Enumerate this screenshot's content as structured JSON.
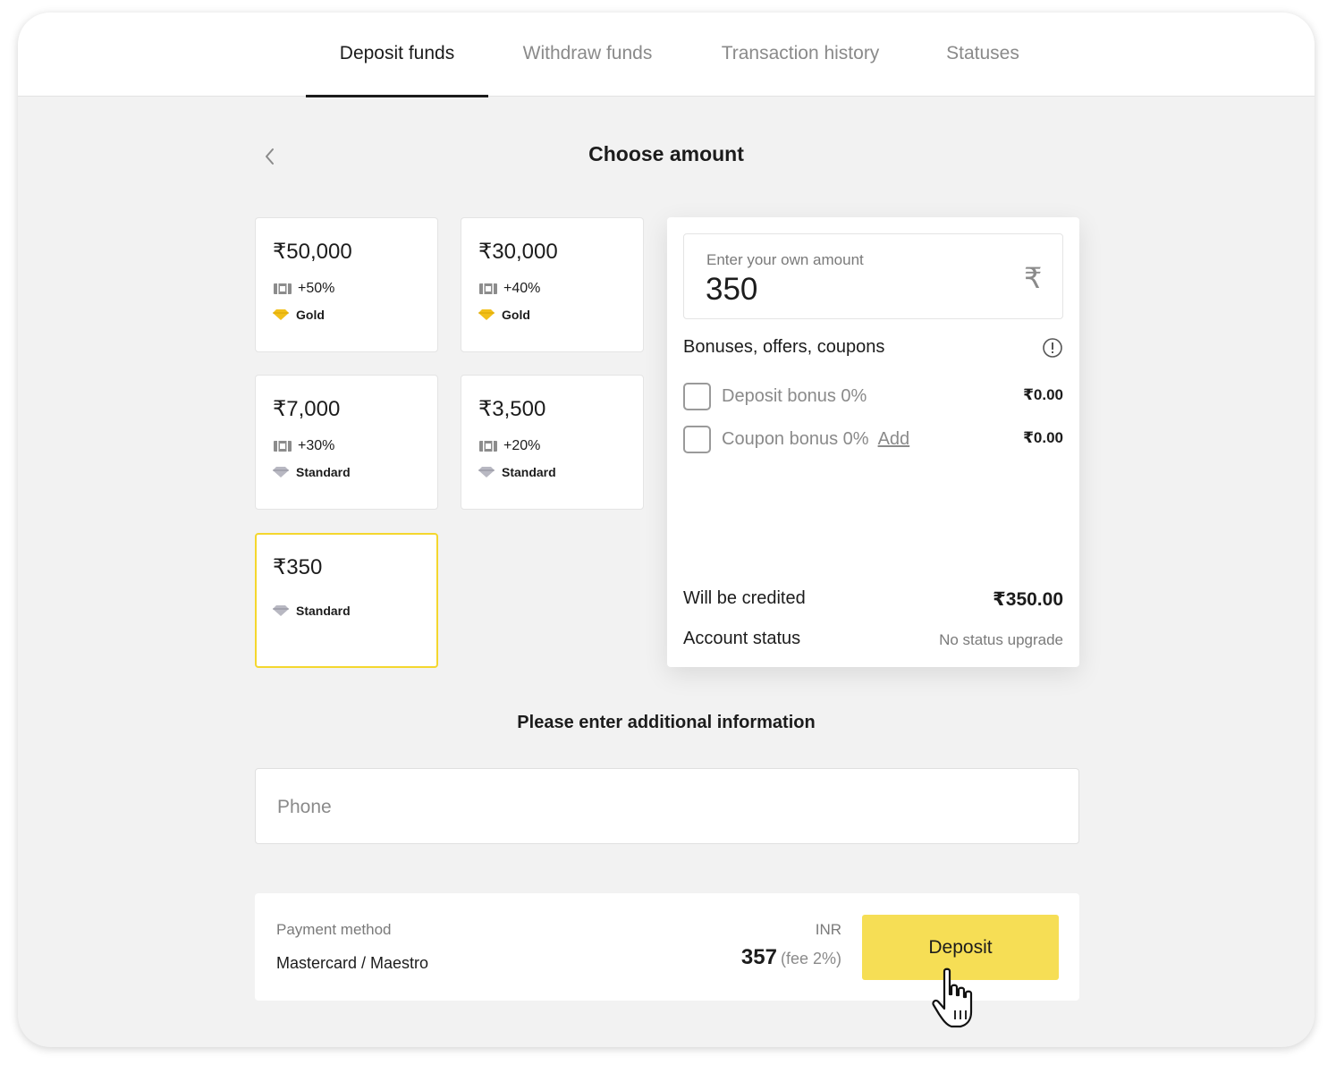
{
  "tabs": [
    {
      "label": "Deposit funds",
      "active": true
    },
    {
      "label": "Withdraw funds",
      "active": false
    },
    {
      "label": "Transaction history",
      "active": false
    },
    {
      "label": "Statuses",
      "active": false
    }
  ],
  "page_title": "Choose amount",
  "amount_options": [
    {
      "amount": "₹50,000",
      "bonus": "+50%",
      "status": "Gold"
    },
    {
      "amount": "₹30,000",
      "bonus": "+40%",
      "status": "Gold"
    },
    {
      "amount": "₹7,000",
      "bonus": "+30%",
      "status": "Standard"
    },
    {
      "amount": "₹3,500",
      "bonus": "+20%",
      "status": "Standard"
    },
    {
      "amount": "₹350",
      "bonus": "",
      "status": "Standard",
      "selected": true
    }
  ],
  "custom_amount": {
    "label": "Enter your own amount",
    "value": "350",
    "currency_symbol": "₹"
  },
  "bonuses": {
    "heading": "Bonuses, offers, coupons",
    "deposit_bonus": {
      "label": "Deposit bonus 0%",
      "value": "₹0.00",
      "checked": false
    },
    "coupon_bonus": {
      "label": "Coupon bonus 0%",
      "link": "Add",
      "value": "₹0.00",
      "checked": false
    }
  },
  "summary": {
    "credited_label": "Will be credited",
    "credited_value": "₹350.00",
    "status_label": "Account status",
    "status_value": "No status upgrade"
  },
  "additional_info": {
    "heading": "Please enter additional information",
    "phone_placeholder": "Phone"
  },
  "payment": {
    "method_label": "Payment method",
    "method_value": "Mastercard / Maestro",
    "currency": "INR",
    "total": "357",
    "fee": "(fee 2%)",
    "deposit_label": "Deposit"
  },
  "colors": {
    "accent": "#f6de55",
    "selected_border": "#f4d72e",
    "gold_gem": "#f2c01a",
    "standard_gem": "#a9a9b3",
    "background": "#f2f2f2"
  }
}
